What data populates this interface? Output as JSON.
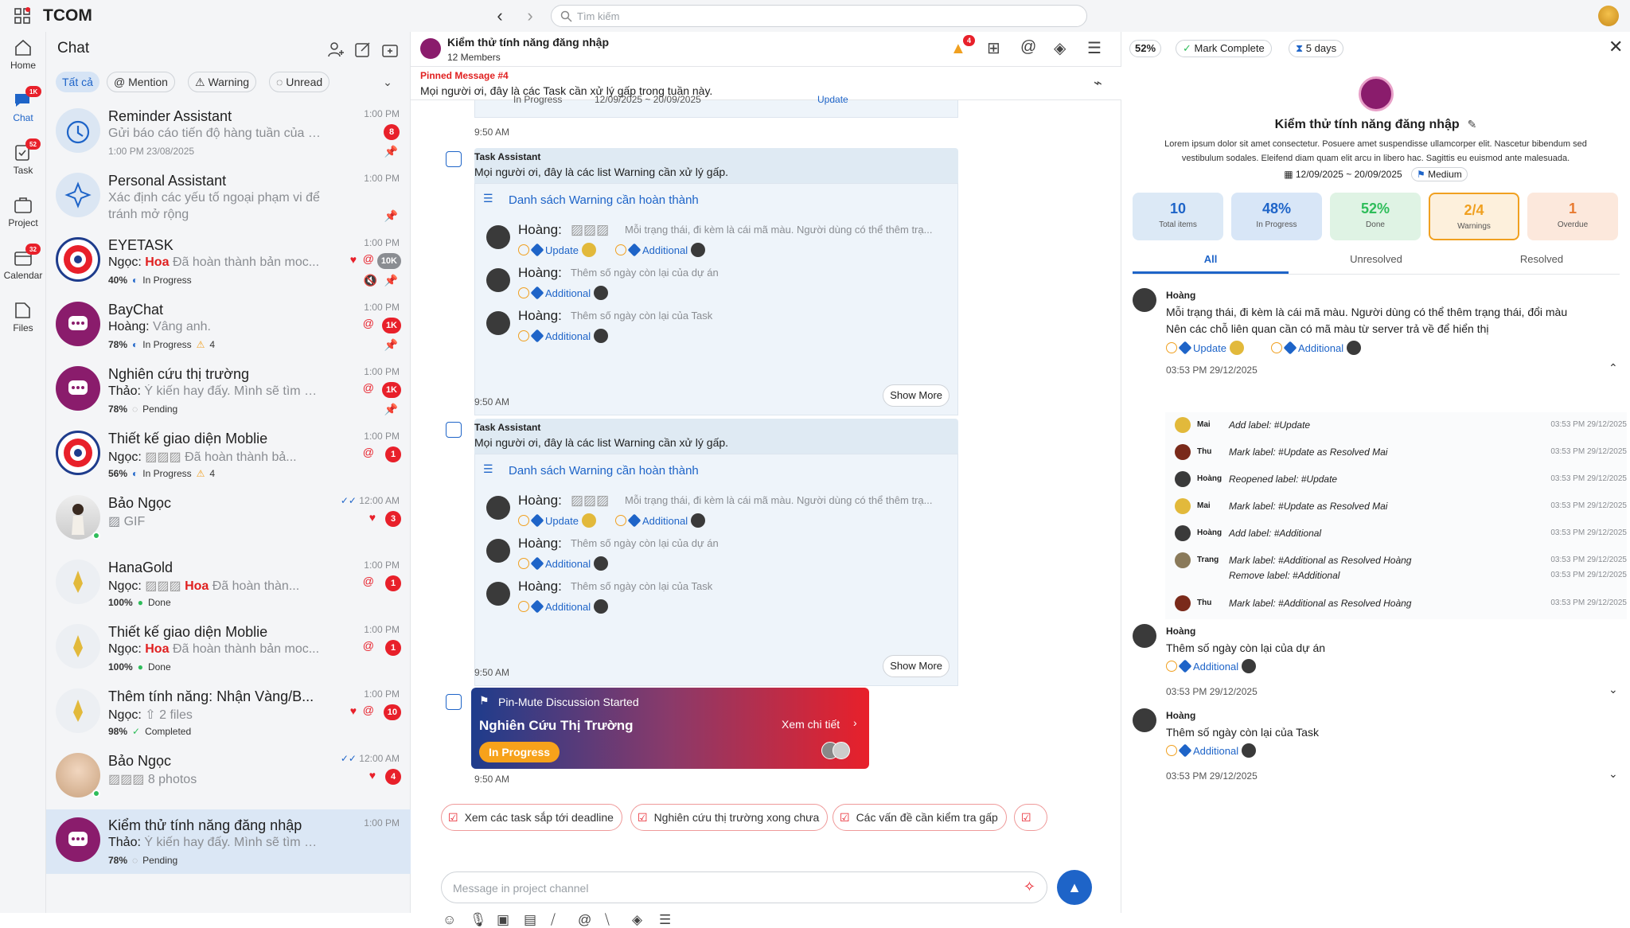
{
  "app": {
    "title": "TCOM",
    "search_placeholder": "Tìm kiếm"
  },
  "nav": [
    {
      "label": "Home"
    },
    {
      "label": "Chat",
      "badge": "1K"
    },
    {
      "label": "Task",
      "badge": "52"
    },
    {
      "label": "Project"
    },
    {
      "label": "Calendar",
      "badge": "32"
    },
    {
      "label": "Files"
    }
  ],
  "chatlist": {
    "title": "Chat",
    "filters": [
      "Tất cả",
      "Mention",
      "Warning",
      "Unread"
    ],
    "rows": [
      {
        "name": "Reminder Assistant",
        "msg": "Gửi báo cáo tiến độ hàng tuần của tí...",
        "sub": "1:00 PM 23/08/2025",
        "time": "1:00 PM",
        "badge": "8"
      },
      {
        "name": "Personal Assistant",
        "msg": "Xác định các yếu tố ngoại phạm vi để",
        "msg2": "tránh mở rộng",
        "time": "1:00 PM"
      },
      {
        "name": "EYETASK",
        "sender": "Ngọc:",
        "hl": "Hoa",
        "msg": "Đã hoàn thành bản moc...",
        "pct": "40%",
        "status": "In Progress",
        "time": "1:00 PM",
        "badge": "10K"
      },
      {
        "name": "BayChat",
        "sender": "Hoàng:",
        "msg": "Vâng anh.",
        "pct": "78%",
        "status": "In Progress",
        "warn": "4",
        "time": "1:00 PM",
        "badge": "1K"
      },
      {
        "name": "Nghiên cứu thị trường",
        "sender": "Thảo:",
        "msg": "Ý kiến hay đấy. Mình sẽ tìm hi...",
        "pct": "78%",
        "status": "Pending",
        "time": "1:00 PM",
        "badge": "1K"
      },
      {
        "name": "Thiết kế giao diện Moblie",
        "sender": "Ngọc:",
        "msg": "Đã hoàn thành bả...",
        "pct": "56%",
        "status": "In Progress",
        "warn": "4",
        "time": "1:00 PM",
        "badge": "1"
      },
      {
        "name": "Bảo Ngọc",
        "msg": "GIF",
        "time": "12:00 AM",
        "badge": "3"
      },
      {
        "name": "HanaGold",
        "sender": "Ngọc:",
        "hl": "Hoa",
        "msg": "Đã hoàn thàn...",
        "pct": "100%",
        "status": "Done",
        "time": "1:00 PM",
        "badge": "1"
      },
      {
        "name": "Thiết kế giao diện Moblie",
        "sender": "Ngọc:",
        "hl": "Hoa",
        "msg": "Đã hoàn thành bản moc...",
        "pct": "100%",
        "status": "Done",
        "time": "1:00 PM",
        "badge": "1"
      },
      {
        "name": "Thêm tính năng: Nhận Vàng/B...",
        "sender": "Ngọc:",
        "msg": "2 files",
        "pct": "98%",
        "status": "Completed",
        "time": "1:00 PM",
        "badge": "10"
      },
      {
        "name": "Bảo Ngọc",
        "msg": "8 photos",
        "time": "12:00 AM",
        "badge": "4"
      },
      {
        "name": "Kiểm thử tính năng đăng nhập",
        "sender": "Thảo:",
        "msg": "Ý kiến hay đấy. Mình sẽ tìm hi...",
        "pct": "78%",
        "status": "Pending",
        "time": "1:00 PM"
      }
    ]
  },
  "channel": {
    "title": "Kiểm thử tính năng đăng nhập",
    "members": "12 Members",
    "alert_badge": "4",
    "pinned_label": "Pinned Message #4",
    "pinned_text": "Mọi người ơi, đây là các Task cần xử lý gấp trong tuần này.",
    "partial_tags": {
      "status": "In Progress",
      "dates": "12/09/2025 ~ 20/09/2025",
      "tag": "Update"
    },
    "time1": "9:50 AM",
    "assistant": {
      "name": "Task Assistant",
      "text": "Mọi người ơi, đây là các list Warning cần xử lý gấp.",
      "list_title": "Danh sách Warning cần hoàn thành",
      "items": [
        {
          "name": "Hoàng:",
          "text": "Mỗi trạng thái, đi kèm là cái mã màu. Người dùng có thể thêm trạ...",
          "tags": [
            "Update",
            "Additional"
          ]
        },
        {
          "name": "Hoàng:",
          "text": "Thêm số ngày còn lại của dự án",
          "tags": [
            "Additional"
          ]
        },
        {
          "name": "Hoàng:",
          "text": "Thêm số ngày còn lại của Task",
          "tags": [
            "Additional"
          ]
        }
      ],
      "show_more": "Show More"
    },
    "time2": "9:50 AM",
    "time3": "9:50 AM",
    "banner": {
      "label": "Pin-Mute Discussion Started",
      "title": "Nghiên Cứu Thị Trường",
      "link": "Xem chi tiết",
      "status": "In Progress"
    },
    "time4": "9:50 AM",
    "suggestions": [
      "Xem các task sắp tới deadline",
      "Nghiên cứu thị trường xong chưa",
      "Các vấn đề cần kiểm tra gấp"
    ],
    "input_placeholder": "Message in project channel"
  },
  "detail": {
    "progress": "52%",
    "mark_complete": "Mark Complete",
    "days": "5 days",
    "title": "Kiểm thử tính năng đăng nhập",
    "desc1": "Lorem ipsum dolor sit amet consectetur. Posuere amet suspendisse ullamcorper elit. Nascetur bibendum sed",
    "desc2": "vestibulum sodales. Eleifend diam quam elit arcu in libero hac. Sagittis eu euismod ante malesuada.",
    "dates": "12/09/2025 ~ 20/09/2025",
    "priority": "Medium",
    "stats": [
      {
        "value": "10",
        "label": "Total items"
      },
      {
        "value": "48%",
        "label": "In Progress"
      },
      {
        "value": "52%",
        "label": "Done"
      },
      {
        "value": "2/4",
        "label": "Warnings"
      },
      {
        "value": "1",
        "label": "Overdue"
      }
    ],
    "tabs": [
      "All",
      "Unresolved",
      "Resolved"
    ],
    "entries": [
      {
        "name": "Hoàng",
        "line1": "Mỗi trạng thái, đi kèm là cái mã màu. Người dùng có thể thêm trạng thái, đổi màu",
        "line2": "Nên các chỗ liên quan cần có mã màu từ server trả về để hiển thị",
        "tags": [
          "Update",
          "Additional"
        ],
        "time": "03:53 PM 29/12/2025"
      },
      {
        "name": "Hoàng",
        "line1": "Thêm số ngày còn lại của dự án",
        "tags": [
          "Additional"
        ],
        "time": "03:53 PM 29/12/2025"
      },
      {
        "name": "Hoàng",
        "line1": "Thêm số ngày còn lại của Task",
        "tags": [
          "Additional"
        ],
        "time": "03:53 PM 29/12/2025"
      }
    ],
    "history": [
      {
        "who": "Mai",
        "text": "Add label: #Update",
        "time": "03:53 PM 29/12/2025"
      },
      {
        "who": "Thu",
        "text": "Mark label: #Update as Resolved Mai",
        "time": "03:53 PM 29/12/2025"
      },
      {
        "who": "Hoàng",
        "text": "Reopened label: #Update",
        "time": "03:53 PM 29/12/2025"
      },
      {
        "who": "Mai",
        "text": "Mark label: #Update as Resolved Mai",
        "time": "03:53 PM 29/12/2025"
      },
      {
        "who": "Hoàng",
        "text": "Add label: #Additional",
        "time": "03:53 PM 29/12/2025"
      },
      {
        "who": "Trang",
        "text": "Mark label: #Additional as Resolved Hoàng",
        "text2": "Remove label: #Additional",
        "time": "03:53 PM 29/12/2025",
        "time2": "03:53 PM 29/12/2025"
      },
      {
        "who": "Thu",
        "text": "Mark label: #Additional as Resolved Hoàng",
        "time": "03:53 PM 29/12/2025"
      }
    ]
  }
}
